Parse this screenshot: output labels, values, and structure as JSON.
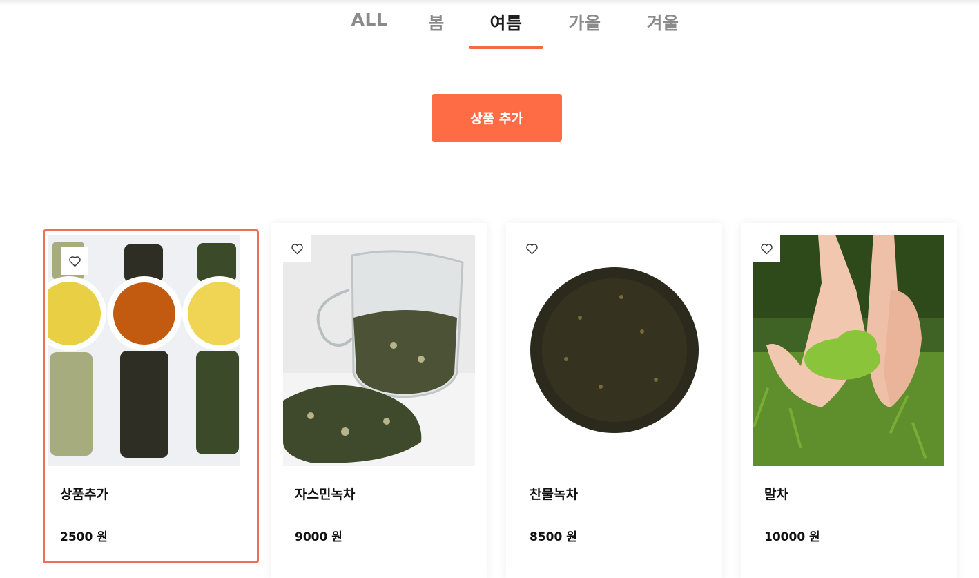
{
  "tabs": [
    {
      "label": "ALL",
      "active": false
    },
    {
      "label": "봄",
      "active": false
    },
    {
      "label": "여름",
      "active": true
    },
    {
      "label": "가을",
      "active": false
    },
    {
      "label": "겨울",
      "active": false
    }
  ],
  "add_button": {
    "label": "상품 추가"
  },
  "accent_color": "#fd6c45",
  "selected_outline_color": "#ef6f57",
  "products": [
    {
      "name": "상품추가",
      "price": "2500 원",
      "favorite_icon": "heart-outline-icon",
      "image": "three-tea-cups-with-leaves",
      "selected": true
    },
    {
      "name": "자스민녹차",
      "price": "9000 원",
      "favorite_icon": "heart-outline-icon",
      "image": "jasmine-tea-in-glass-pitcher",
      "selected": false
    },
    {
      "name": "찬물녹차",
      "price": "8500 원",
      "favorite_icon": "heart-outline-icon",
      "image": "pile-of-dark-tea-leaves",
      "selected": false
    },
    {
      "name": "말차",
      "price": "10000 원",
      "favorite_icon": "heart-outline-icon",
      "image": "hands-holding-green-tea-leaves",
      "selected": false
    }
  ]
}
